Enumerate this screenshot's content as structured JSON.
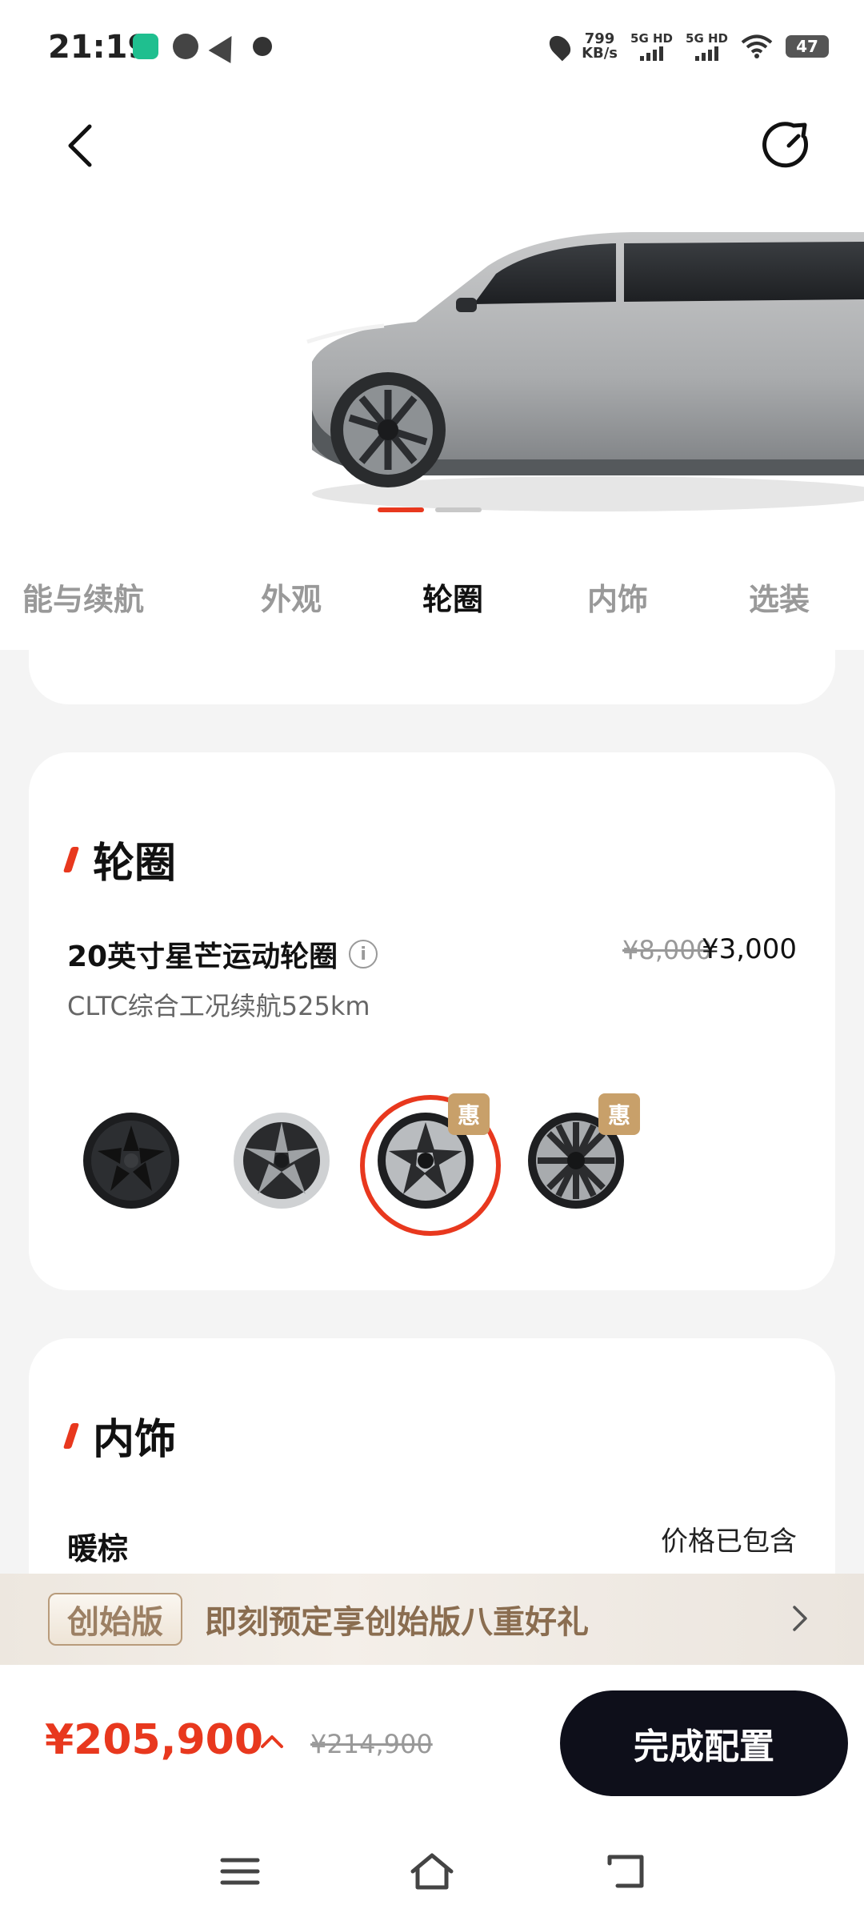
{
  "status_bar": {
    "time": "21:19",
    "net_speed_value": "799",
    "net_speed_unit": "KB/s",
    "sim1": "5G HD",
    "sim2": "5G HD",
    "battery": "47"
  },
  "tabs": [
    {
      "label": "能与续航",
      "active": false
    },
    {
      "label": "外观",
      "active": false
    },
    {
      "label": "轮圈",
      "active": true
    },
    {
      "label": "内饰",
      "active": false
    },
    {
      "label": "选装",
      "active": false
    }
  ],
  "carousel": {
    "count": 2,
    "active_index": 0
  },
  "wheel_section": {
    "title": "轮圈",
    "selected_name": "20英寸星芒运动轮圈",
    "range": "CLTC综合工况续航525km",
    "price_original": "¥8,000",
    "price_current": "¥3,000",
    "options": [
      {
        "style": "black-aero",
        "selected": false,
        "badge": ""
      },
      {
        "style": "silver-black-star",
        "selected": false,
        "badge": ""
      },
      {
        "style": "two-tone-sport",
        "selected": true,
        "badge": "惠"
      },
      {
        "style": "multi-spoke",
        "selected": false,
        "badge": "惠"
      }
    ]
  },
  "interior_section": {
    "title": "内饰",
    "color_name": "暖棕",
    "price_note": "价格已包含"
  },
  "promo": {
    "badge": "创始版",
    "text": "即刻预定享创始版八重好礼"
  },
  "summary": {
    "total_price": "¥205,900",
    "original_price": "¥214,900",
    "done_label": "完成配置"
  },
  "colors": {
    "accent": "#e8381e",
    "dark_button": "#0e0f1a",
    "promo_text": "#8a6d50",
    "badge_gold": "#c8a06a"
  }
}
